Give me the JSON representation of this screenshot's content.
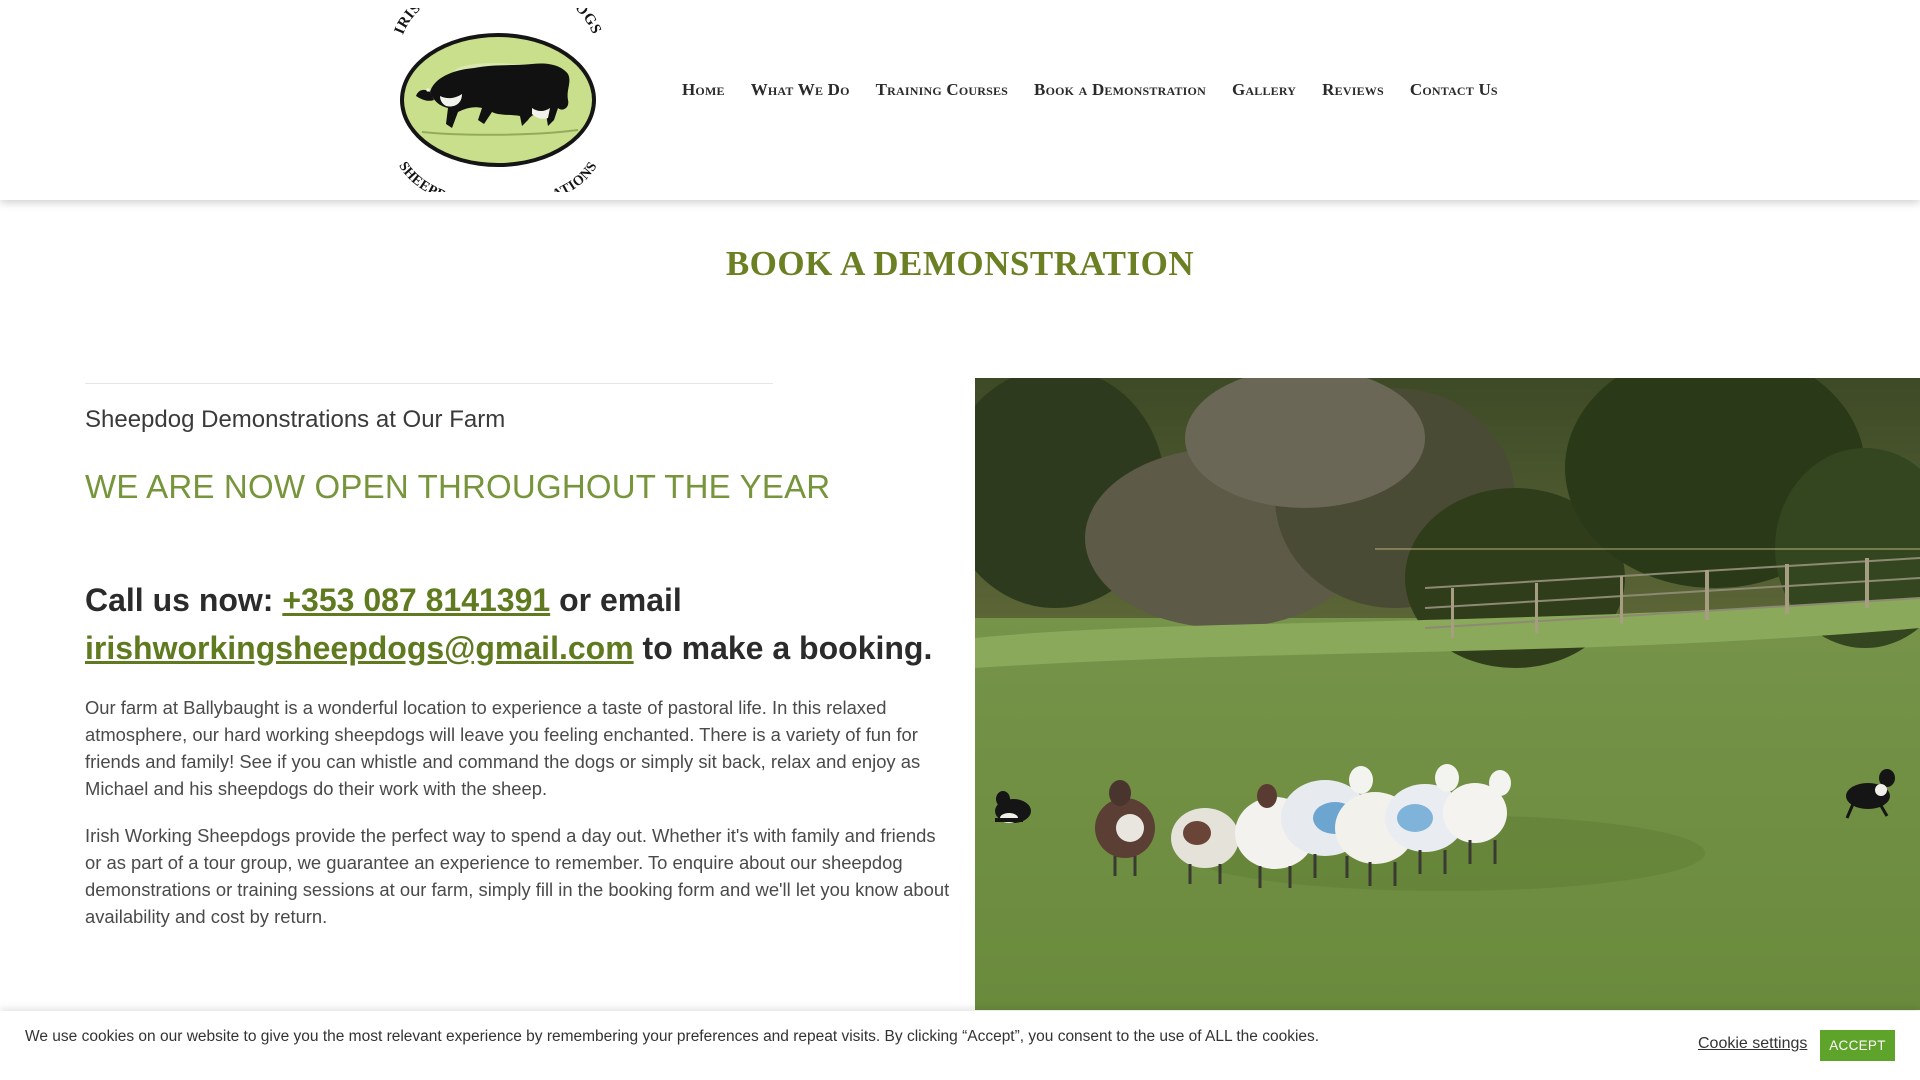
{
  "header": {
    "logo": {
      "top_text": "IRISH WORKING SHEEPDOGS",
      "bottom_text": "SHEEPDOG DEMONSTRATIONS",
      "colors": {
        "oval": "#c9df8c",
        "ring": "#151515",
        "dog": "#111111"
      }
    },
    "nav": [
      "Home",
      "What We Do",
      "Training Courses",
      "Book a Demonstration",
      "Gallery",
      "Reviews",
      "Contact Us"
    ]
  },
  "page_title": "BOOK A DEMONSTRATION",
  "content": {
    "subheading": "Sheepdog Demonstrations at Our Farm",
    "open_banner": "WE ARE NOW OPEN THROUGHOUT THE YEAR",
    "booking": {
      "prefix": "Call us now: ",
      "phone": "+353 087 8141391",
      "middle": " or email ",
      "email": "irishworkingsheepdogs@gmail.com",
      "suffix": " to make a booking."
    },
    "paragraphs": [
      "Our farm at Ballybaught is a wonderful location to experience a taste of pastoral life. In this relaxed atmosphere, our hard working sheepdogs will leave you feeling enchanted. There is a variety of fun for friends and family! See if you can whistle and command the dogs or simply sit back, relax and enjoy as Michael and his sheepdogs do their work with the sheep.",
      "Irish Working Sheepdogs provide the perfect way to spend a day out. Whether it's with family and friends or as part of a tour group, we guarantee an experience to remember. To enquire about our sheepdog demonstrations or training sessions at our farm, simply fill in the booking form and we'll let you know about availability and cost by return."
    ]
  },
  "cookie": {
    "text": "We use cookies on our website to give you the most relevant experience by remembering your preferences and repeat visits. By clicking “Accept”, you consent to the use of ALL the cookies.",
    "settings_label": "Cookie settings",
    "accept_label": "ACCEPT"
  },
  "colors": {
    "title": "#6b7f23",
    "banner": "#77953a",
    "link": "#5f7a1f",
    "accept_button": "#5fa42a"
  }
}
